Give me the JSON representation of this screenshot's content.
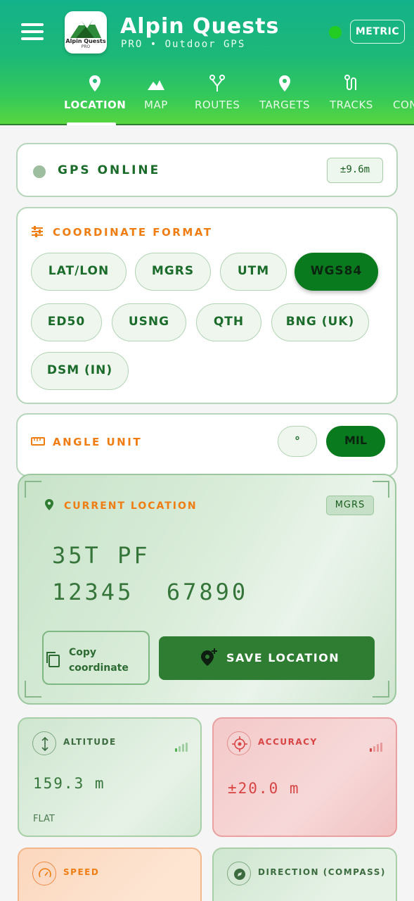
{
  "header": {
    "app_title": "Alpin Quests",
    "app_subtitle": "PRO • Outdoor GPS",
    "logo_text": "Alpin Quests",
    "logo_sub": "PRO",
    "units_button": "METRIC",
    "status_color": "#22cc22"
  },
  "tabs": [
    {
      "label": "LOCATION",
      "icon": "pin-icon",
      "active": true
    },
    {
      "label": "MAP",
      "icon": "mountain-icon",
      "active": false
    },
    {
      "label": "ROUTES",
      "icon": "routes-icon",
      "active": false
    },
    {
      "label": "TARGETS",
      "icon": "target-pin-icon",
      "active": false
    },
    {
      "label": "TRACKS",
      "icon": "tracks-icon",
      "active": false
    },
    {
      "label": "CON",
      "icon": "",
      "active": false
    }
  ],
  "gps": {
    "label": "GPS ONLINE",
    "accuracy": "±9.6m"
  },
  "coordinate_format": {
    "title": "COORDINATE FORMAT",
    "options": [
      "LAT/LON",
      "MGRS",
      "UTM",
      "WGS84",
      "ED50",
      "USNG",
      "QTH",
      "BNG (UK)",
      "DSM (IN)"
    ],
    "selected": "WGS84"
  },
  "angle_unit": {
    "title": "ANGLE UNIT",
    "options": [
      "°",
      "MIL"
    ],
    "selected": "MIL"
  },
  "current_location": {
    "title": "CURRENT LOCATION",
    "badge": "MGRS",
    "line1": "35T PF",
    "line2": "12345  67890",
    "copy_label": "Copy coordinate",
    "save_label": "SAVE LOCATION"
  },
  "metrics": {
    "altitude": {
      "label": "ALTITUDE",
      "value": "159.3 m",
      "sub": "FLAT"
    },
    "accuracy": {
      "label": "ACCURACY",
      "value": "±20.0 m"
    },
    "speed": {
      "label": "SPEED"
    },
    "direction": {
      "label": "DIRECTION (COMPASS)"
    }
  },
  "colors": {
    "brand_green": "#0a7a1f",
    "accent_orange": "#ef7d12",
    "header_teal": "#14b28a"
  }
}
